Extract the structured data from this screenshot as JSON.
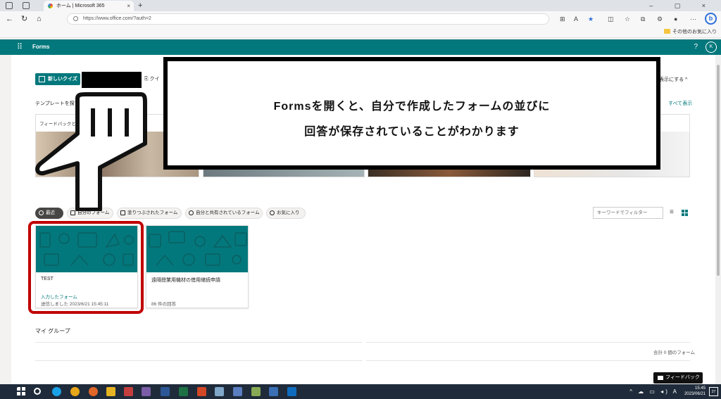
{
  "browser": {
    "tab_title": "ホーム | Microsoft 365",
    "tab_close": "×",
    "new_tab": "+",
    "url": "https://www.office.com/?auth=2",
    "win_controls": "– ▢ ×",
    "favorites_folder": "その他のお気に入り",
    "profile_menu": "···",
    "bing": "b"
  },
  "forms_header": {
    "app_name": "Forms",
    "help": "?",
    "user_initial": "K"
  },
  "toolbar": {
    "new_quiz_label": "新しいクイズ",
    "quick_label": "クイ",
    "hide_label": "表示にする ^"
  },
  "templates": {
    "heading": "テンプレートを探す",
    "see_all": "すべて表示",
    "first_card_label": "フィードバックと..."
  },
  "filters": {
    "chips": [
      "最近",
      "自分のフォーム",
      "塗りつぶされたフォーム",
      "自分と共有されているフォーム",
      "お気に入り"
    ],
    "filter_placeholder": "キーワードでフィルター"
  },
  "forms": [
    {
      "title": "TEST",
      "kind": "入力したフォーム",
      "meta": "送信しました 2023/6/21 15:45:11"
    },
    {
      "title": "遠隔授業用機材の借用継続申請",
      "kind": "",
      "meta": "86 件の回答"
    }
  ],
  "groups": {
    "heading": "マイ グループ",
    "total": "合計 0 個のフォーム"
  },
  "feedback_label": "フィードバック",
  "callout": {
    "line1": "Formsを開くと、自分で作成したフォームの並びに",
    "line2": "回答が保存されていることがわかります"
  },
  "taskbar": {
    "time": "15:45",
    "date": "2023/06/21",
    "ime": "A",
    "notifications": "27"
  },
  "colors": {
    "forms_teal": "#03787c",
    "highlight_red": "#c00000"
  }
}
